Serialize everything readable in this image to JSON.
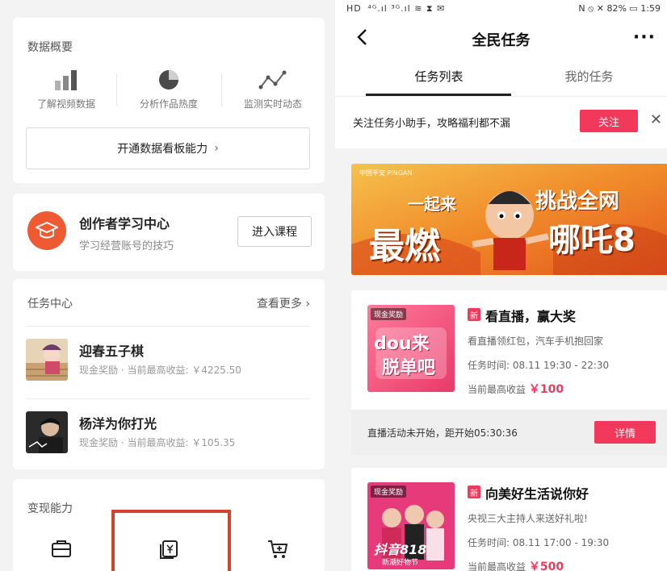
{
  "left": {
    "overview": {
      "title": "数据概要",
      "items": [
        {
          "label": "了解视频数据",
          "icon": "bar-chart-icon"
        },
        {
          "label": "分析作品热度",
          "icon": "pie-chart-icon"
        },
        {
          "label": "监测实时动态",
          "icon": "line-chart-icon"
        }
      ],
      "button_label": "开通数据看板能力",
      "chevron": "›"
    },
    "learn": {
      "title": "创作者学习中心",
      "subtitle": "学习经营账号的技巧",
      "button_label": "进入课程",
      "icon": "graduation-cap-icon"
    },
    "tasks": {
      "title": "任务中心",
      "more_label": "查看更多 ›",
      "items": [
        {
          "title": "迎春五子棋",
          "subtitle": "现金奖励 · 当前最高收益: ￥4225.50"
        },
        {
          "title": "杨洋为你打光",
          "subtitle": "现金奖励 · 当前最高收益: ￥105.35"
        }
      ]
    },
    "monetization": {
      "title": "变现能力",
      "icons": [
        "wallet-icon",
        "yuan-coupon-icon",
        "cart-plus-icon"
      ]
    }
  },
  "right": {
    "status": {
      "left": "HD  ⁴ᴳ.ıl ³ᴳ.ıl ≋ ⧗ ✉",
      "right": "N ⦸ ✕ 82% ▭ 1:59"
    },
    "nav": {
      "title": "全民任务",
      "more": "···"
    },
    "tabs": [
      {
        "label": "任务列表",
        "active": true
      },
      {
        "label": "我的任务",
        "active": false
      }
    ],
    "follow": {
      "text": "关注任务小助手，攻略福利都不漏",
      "button": "关注",
      "close": "✕"
    },
    "banner": {
      "brand": "中国平安 PINGAN",
      "line1": "一起来",
      "line2": "最燃",
      "line3": "挑战全网",
      "line4": "哪吒8"
    },
    "cards": [
      {
        "badge": "现金奖励",
        "thumb_text_1": "dou来",
        "thumb_text_2": "脱单吧",
        "new": "新",
        "title": "看直播，赢大奖",
        "desc": "看直播领红包，汽车手机抱回家",
        "time": "任务时间: 08.11 19:30 - 22:30",
        "reward_label": "当前最高收益",
        "reward": "￥100",
        "footer": "直播活动未开始，距开始05:30:36",
        "detail": "详情"
      },
      {
        "badge": "现金奖励",
        "thumb_text_1": "抖音818",
        "thumb_text_2": "新潮好物节",
        "new": "新",
        "title": "向美好生活说你好",
        "desc": "央视三大主持人来送好礼啦!",
        "time": "任务时间: 08.11 17:00 - 19:30",
        "reward_label": "当前最高收益",
        "reward": "￥500"
      }
    ]
  },
  "colors": {
    "accent": "#f2395b",
    "orange": "#ef5a33",
    "highlight": "#d3432f"
  }
}
